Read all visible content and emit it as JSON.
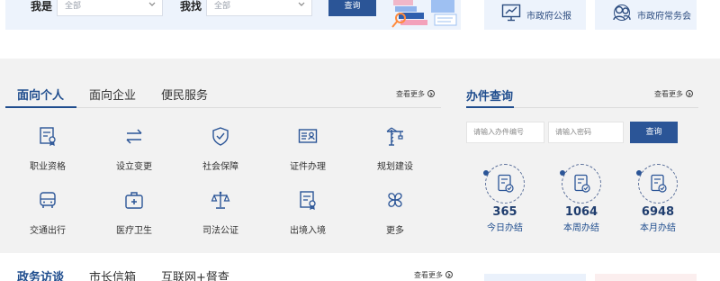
{
  "search": {
    "label_iam": "我是",
    "select_iam": "全部",
    "label_find": "我找",
    "select_find": "全部",
    "button": "查询"
  },
  "quick_links": [
    {
      "label": "市政府公报",
      "icon": "chart-screen-icon"
    },
    {
      "label": "市政府常务会",
      "icon": "meeting-people-icon"
    }
  ],
  "services": {
    "tabs": [
      "面向个人",
      "面向企业",
      "便民服务"
    ],
    "active_tab": 0,
    "more": "查看更多",
    "items": [
      {
        "label": "职业资格",
        "icon": "certificate-icon"
      },
      {
        "label": "设立变更",
        "icon": "swap-arrows-icon"
      },
      {
        "label": "社会保障",
        "icon": "shield-check-icon"
      },
      {
        "label": "证件办理",
        "icon": "id-card-icon"
      },
      {
        "label": "规划建设",
        "icon": "crane-icon"
      },
      {
        "label": "交通出行",
        "icon": "bus-icon"
      },
      {
        "label": "医疗卫生",
        "icon": "medical-kit-icon"
      },
      {
        "label": "司法公证",
        "icon": "scales-icon"
      },
      {
        "label": "出境入境",
        "icon": "passport-icon"
      },
      {
        "label": "更多",
        "icon": "four-petal-icon"
      }
    ]
  },
  "query_panel": {
    "title": "办件查询",
    "more": "查看更多",
    "case_placeholder": "请输入办件编号",
    "password_placeholder": "请输入密码",
    "button": "查询",
    "stats": [
      {
        "value": "365",
        "caption": "今日办结"
      },
      {
        "value": "1064",
        "caption": "本周办结"
      },
      {
        "value": "6948",
        "caption": "本月办结"
      }
    ]
  },
  "bottom": {
    "tabs": [
      "政务访谈",
      "市长信箱",
      "互联网+督查"
    ],
    "active_tab": 0,
    "more": "查看更多"
  },
  "colors": {
    "brand": "#2b5597",
    "title": "#1f4d8e",
    "panel_bg": "#f2f2f2",
    "light_blue": "#edf3fc"
  }
}
